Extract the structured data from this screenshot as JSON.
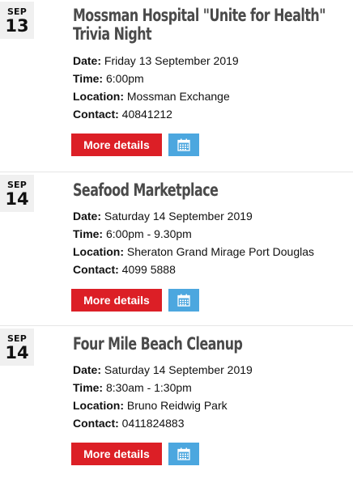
{
  "events": [
    {
      "month": "SEP",
      "day": "13",
      "title": "Mossman Hospital \"Unite for Health\" Trivia Night",
      "date_label": "Date:",
      "date": "Friday 13 September 2019",
      "time_label": "Time:",
      "time": "6:00pm",
      "location_label": "Location:",
      "location": "Mossman Exchange",
      "contact_label": "Contact:",
      "contact": "40841212",
      "more_label": "More details",
      "calendar_icon": "calendar-icon"
    },
    {
      "month": "SEP",
      "day": "14",
      "title": "Seafood Marketplace",
      "date_label": "Date:",
      "date": "Saturday 14 September 2019",
      "time_label": "Time:",
      "time": "6:00pm - 9.30pm",
      "location_label": "Location:",
      "location": "Sheraton Grand Mirage Port Douglas",
      "contact_label": "Contact:",
      "contact": "4099 5888",
      "more_label": "More details",
      "calendar_icon": "calendar-icon"
    },
    {
      "month": "SEP",
      "day": "14",
      "title": "Four Mile Beach Cleanup",
      "date_label": "Date:",
      "date": "Saturday 14 September 2019",
      "time_label": "Time:",
      "time": "8:30am - 1:30pm",
      "location_label": "Location:",
      "location": "Bruno Reidwig Park",
      "contact_label": "Contact:",
      "contact": "0411824883",
      "more_label": "More details",
      "calendar_icon": "calendar-icon"
    }
  ],
  "colors": {
    "more_button": "#dc1f26",
    "calendar_button": "#4ca7df",
    "title": "#4a4a4a",
    "badge_bg": "#f0f0f0"
  }
}
